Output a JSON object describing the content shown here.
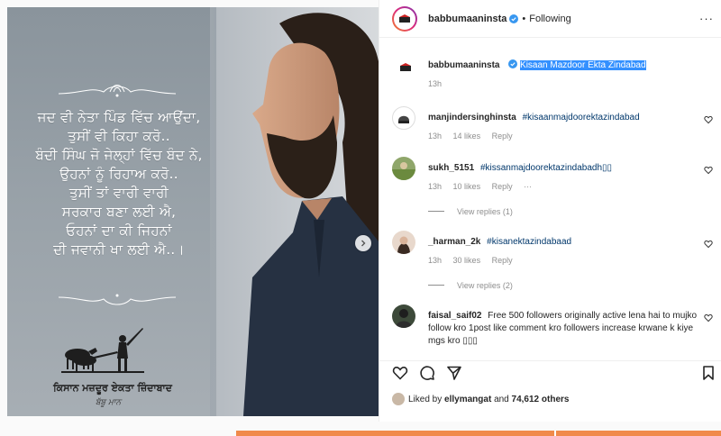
{
  "media": {
    "poem_lines": [
      "ਜਦ ਵੀ ਨੇਤਾ ਪਿੰਡ ਵਿੱਚ ਆਉਂਦਾ,",
      "ਤੁਸੀਂ ਵੀ ਕਿਹਾ ਕਰੋ..",
      "ਬੰਦੀ ਸਿੰਘ ਜੋ ਜੇਲ੍ਹਾਂ ਵਿੱਚ ਬੰਦ ਨੇ,",
      "ਉਹਨਾਂ ਨੂੰ ਰਿਹਾਅ ਕਰੋ..",
      "ਤੁਸੀਂ ਤਾਂ ਵਾਰੀ ਵਾਰੀ",
      "ਸਰਕਾਰ ਬਣਾ ਲਈ ਐ,",
      "ਓਹਨਾਂ ਦਾ ਕੀ ਜਿਹਨਾਂ",
      "ਦੀ ਜਵਾਨੀ ਖਾ ਲਈ ਐ..।"
    ],
    "slogan": "ਕਿਸਾਨ ਮਜ਼ਦੂਰ ਏਕਤਾ ਜ਼ਿੰਦਾਬਾਦ",
    "signature": "ਬੱਬੂ ਮਾਨ"
  },
  "header": {
    "username": "babbumaaninsta",
    "separator": "•",
    "follow_status": "Following",
    "more": "···"
  },
  "caption": {
    "username": "babbumaaninsta",
    "text": "Kisaan Mazdoor Ekta Zindabad",
    "time": "13h"
  },
  "comments": [
    {
      "username": "manjindersinghinsta",
      "text": "#kisaanmajdoorektazindabad",
      "time": "13h",
      "likes": "14 likes",
      "reply": "Reply"
    },
    {
      "username": "sukh_5151",
      "text": "#kissanmajdoorektazindabadh▯▯",
      "time": "13h",
      "likes": "10 likes",
      "reply": "Reply",
      "more": "···",
      "view_replies": "View replies (1)"
    },
    {
      "username": "_harman_2k",
      "text": "#kisanektazindabaad",
      "time": "13h",
      "likes": "30 likes",
      "reply": "Reply",
      "view_replies": "View replies (2)"
    },
    {
      "username": "faisal_saif02",
      "text": "Free 500 followers originally active lena hai to mujko follow kro 1post like comment kro followers increase krwane k kiye mgs kro ▯▯▯",
      "time": "",
      "likes": "",
      "reply": ""
    }
  ],
  "likes": {
    "prefix": "Liked by",
    "user": "ellymangat",
    "and": "and",
    "others": "74,612 others"
  },
  "colors": {
    "link": "#00376b",
    "selection": "#3390ff",
    "verified": "#3897f0",
    "meta": "#8e8e8e",
    "bottom_bar": "#f08a4b"
  },
  "icons": [
    "verified-badge-icon",
    "heart-icon",
    "comment-icon",
    "share-icon",
    "bookmark-icon",
    "chevron-right-icon",
    "more-icon"
  ]
}
